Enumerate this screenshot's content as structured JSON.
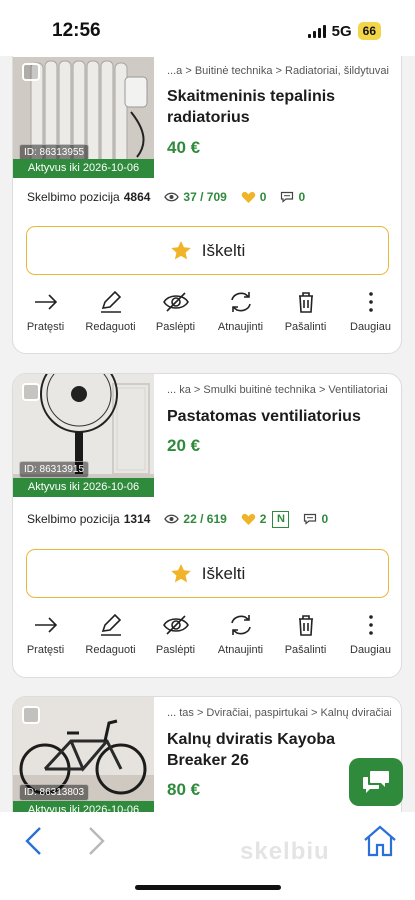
{
  "status_bar": {
    "time": "12:56",
    "network": "5G",
    "battery": "66"
  },
  "common": {
    "promote_label": "Iškelti",
    "position_label": "Skelbimo pozicija",
    "actions": [
      "Pratęsti",
      "Redaguoti",
      "Paslėpti",
      "Atnaujinti",
      "Pašalinti",
      "Daugiau"
    ],
    "colors": {
      "accent_green": "#2f8a3c",
      "promote_border": "#e8b838",
      "star": "#f0b429"
    }
  },
  "listings": [
    {
      "breadcrumb": "...a > Buitinė technika > Radiatoriai, šildytuvai",
      "title": "Skaitmeninis tepalinis radiatorius",
      "price": "40 €",
      "id_label": "ID: 86313955",
      "validity": "Aktyvus iki 2026-10-06",
      "position": "4864",
      "views": "37 / 709",
      "favorites": "0",
      "messages": "0",
      "thumb_icon": "radiator-photo"
    },
    {
      "breadcrumb": "... ka > Smulki buitinė technika > Ventiliatoriai",
      "title": "Pastatomas ventiliatorius",
      "price": "20 €",
      "id_label": "ID: 86313915",
      "validity": "Aktyvus iki 2026-10-06",
      "position": "1314",
      "views": "22 / 619",
      "favorites": "2",
      "new_badge": "N",
      "messages": "0",
      "thumb_icon": "fan-photo"
    },
    {
      "breadcrumb": "... tas > Dviračiai, paspirtukai > Kalnų dviračiai",
      "title": "Kalnų dviratis Kayoba Breaker 26",
      "price": "80 €",
      "id_label": "ID: 86313803",
      "validity": "Aktyvus iki 2026-10-06",
      "thumb_icon": "bicycle-photo"
    }
  ],
  "bottom_bar": {
    "watermark": "skelbiu"
  }
}
